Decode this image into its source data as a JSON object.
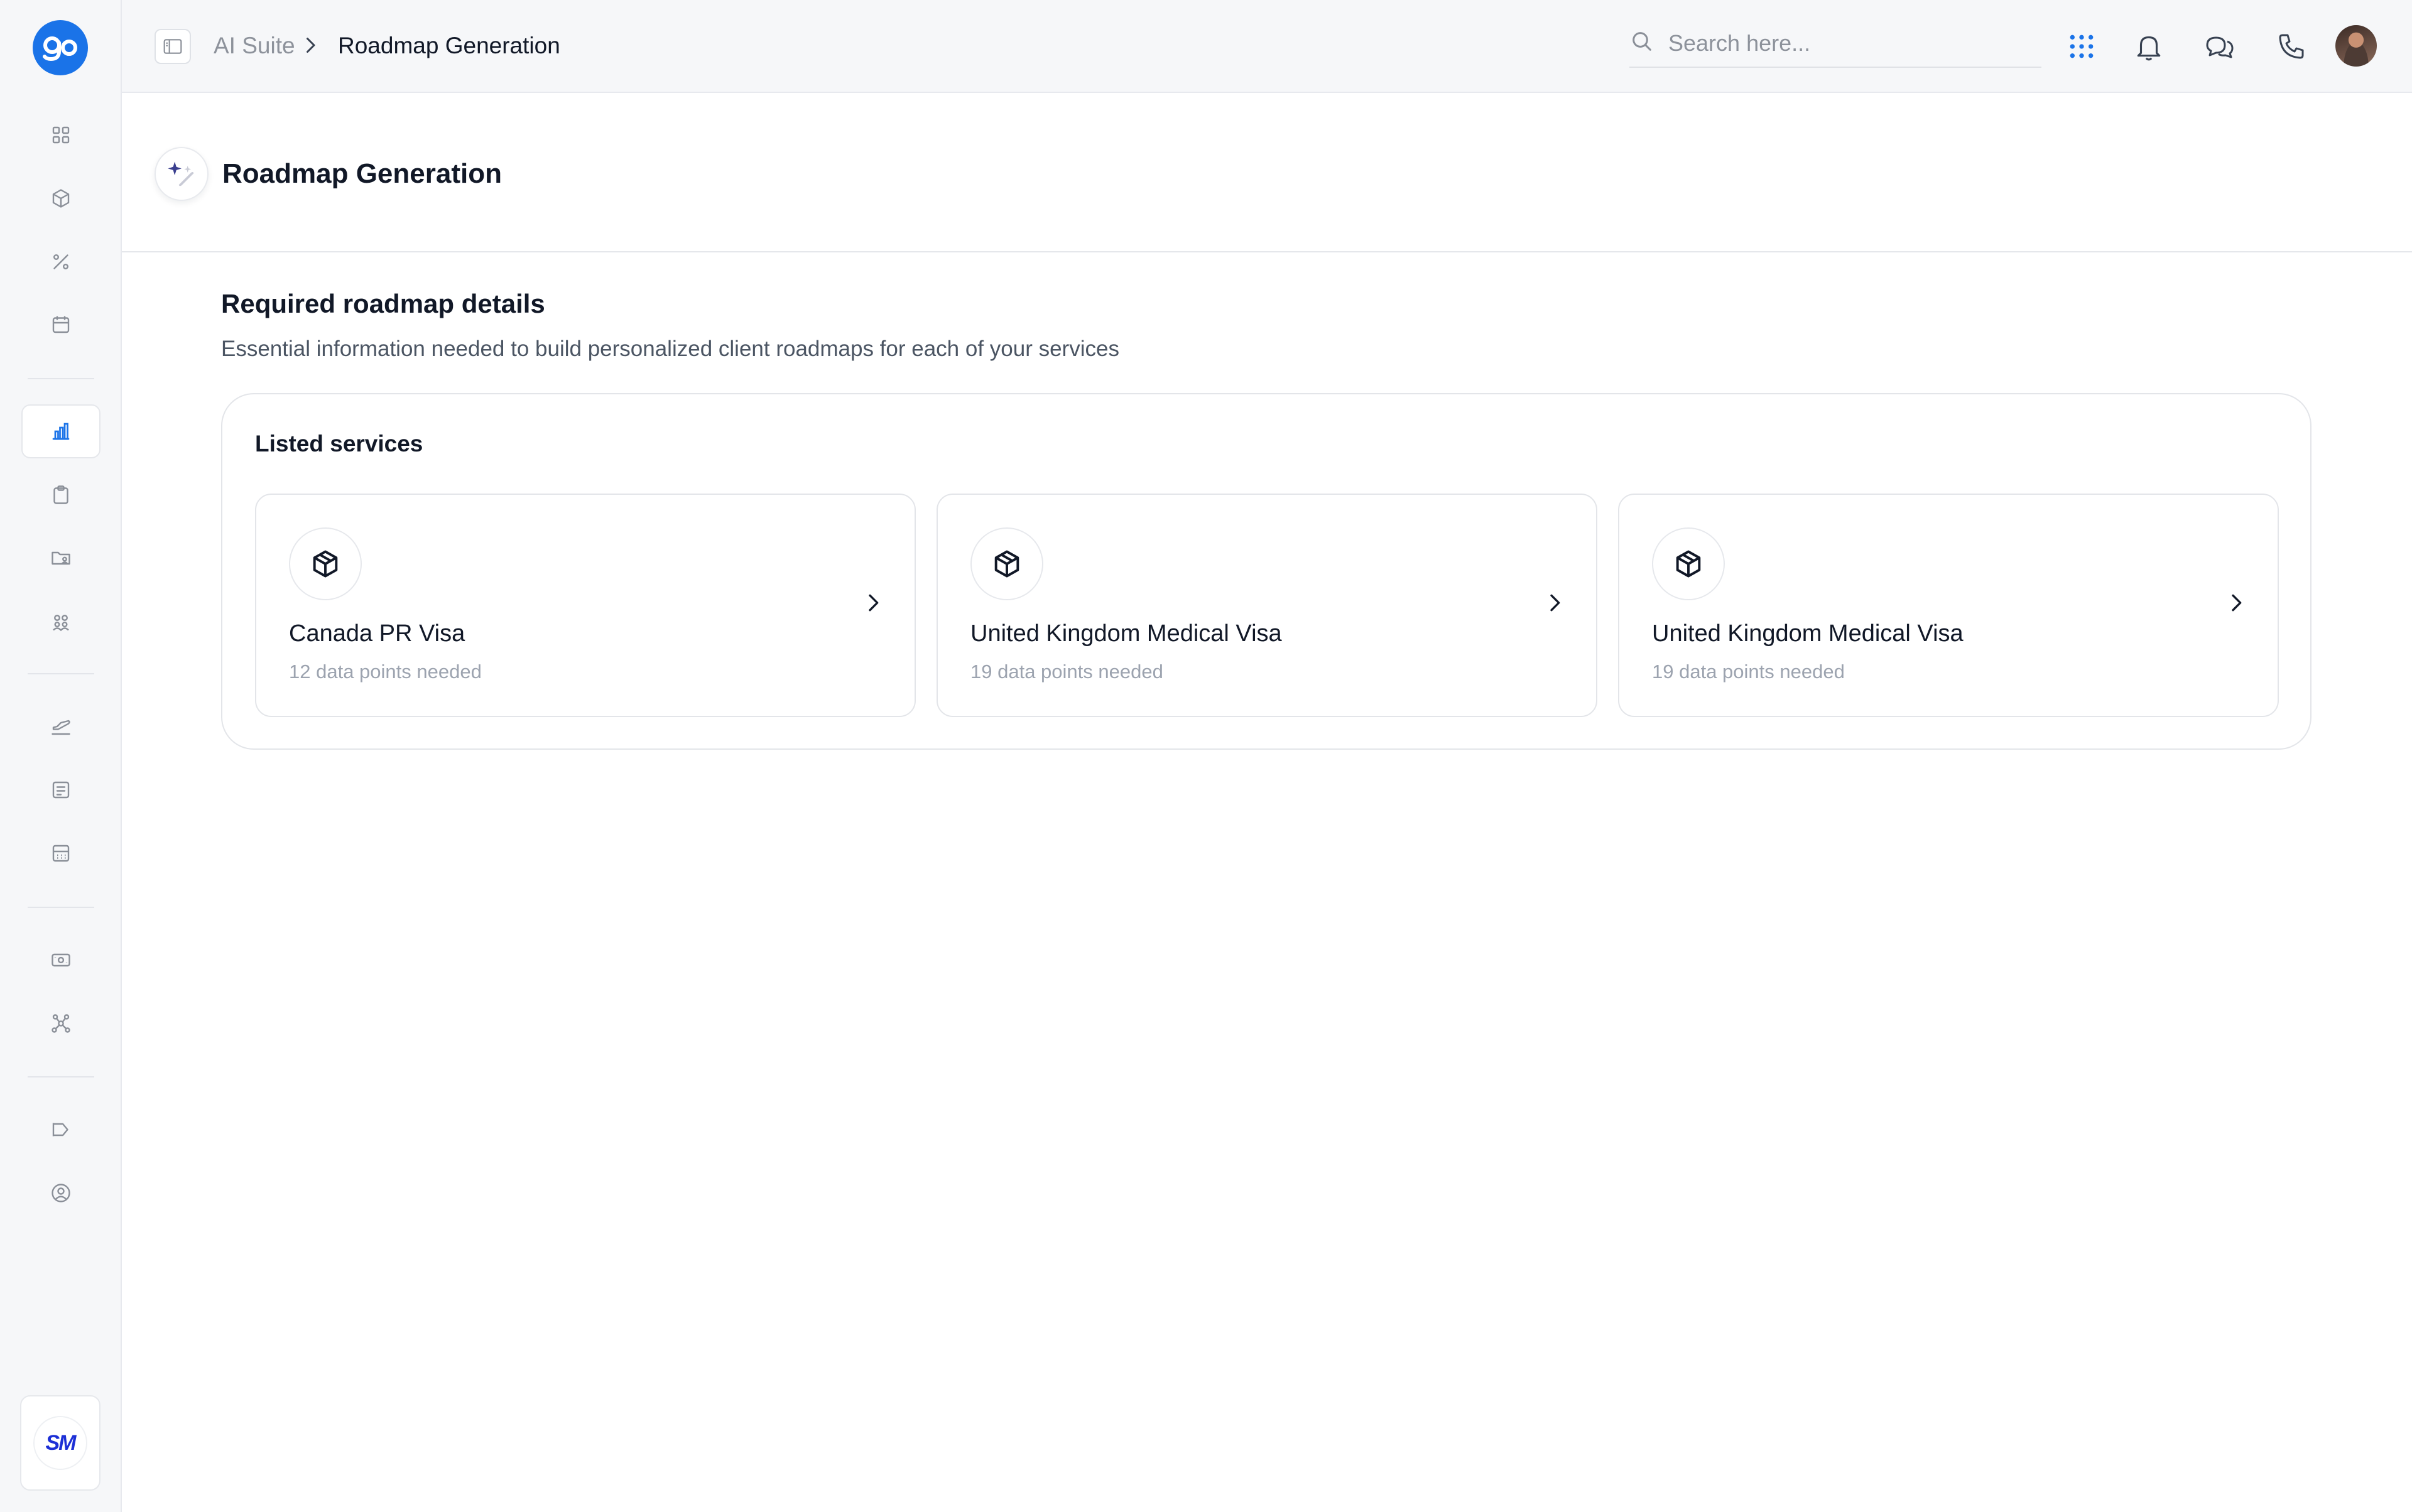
{
  "app": {
    "logo_text": "go",
    "brand_color": "#1a73e8"
  },
  "sidebar": {
    "groups": [
      [
        {
          "icon": "grid-icon",
          "active": false
        },
        {
          "icon": "box-icon",
          "active": false
        },
        {
          "icon": "percent-icon",
          "active": false
        },
        {
          "icon": "calendar-icon",
          "active": false
        }
      ],
      [
        {
          "icon": "bar-chart-icon",
          "active": true
        },
        {
          "icon": "clipboard-icon",
          "active": false
        },
        {
          "icon": "folder-user-icon",
          "active": false
        },
        {
          "icon": "team-icon",
          "active": false
        }
      ],
      [
        {
          "icon": "plane-icon",
          "active": false
        },
        {
          "icon": "document-icon",
          "active": false
        },
        {
          "icon": "calculator-icon",
          "active": false
        }
      ],
      [
        {
          "icon": "banknote-icon",
          "active": false
        },
        {
          "icon": "network-icon",
          "active": false
        }
      ],
      [
        {
          "icon": "megaphone-icon",
          "active": false
        },
        {
          "icon": "user-circle-icon",
          "active": false
        }
      ]
    ],
    "workspace_badge": "SM"
  },
  "topbar": {
    "breadcrumb": {
      "parent": "AI Suite",
      "current": "Roadmap Generation"
    },
    "search_placeholder": "Search here...",
    "icons": [
      "apps-grid-icon",
      "bell-icon",
      "chat-icon",
      "phone-icon",
      "avatar"
    ]
  },
  "page": {
    "title": "Roadmap Generation",
    "section_title": "Required roadmap details",
    "section_subtitle": "Essential information needed to build personalized client roadmaps for each of your services",
    "panel_title": "Listed services",
    "services": [
      {
        "name": "Canada PR Visa",
        "meta": "12 data points needed",
        "icon": "package-icon"
      },
      {
        "name": "United Kingdom Medical Visa",
        "meta": "19 data points needed",
        "icon": "package-icon"
      },
      {
        "name": "United Kingdom Medical Visa",
        "meta": "19 data points needed",
        "icon": "package-icon"
      }
    ]
  }
}
